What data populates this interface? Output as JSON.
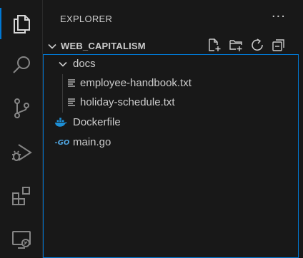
{
  "activity_bar": {
    "items": [
      {
        "icon": "files-icon",
        "active": true
      },
      {
        "icon": "search-icon",
        "active": false
      },
      {
        "icon": "source-control-icon",
        "active": false
      },
      {
        "icon": "run-debug-icon",
        "active": false
      },
      {
        "icon": "extensions-icon",
        "active": false
      },
      {
        "icon": "remote-explorer-icon",
        "active": false
      }
    ]
  },
  "explorer": {
    "title": "EXPLORER",
    "more_label": "···",
    "section": {
      "title": "WEB_CAPITALISM",
      "actions": [
        "new-file-icon",
        "new-folder-icon",
        "refresh-icon",
        "collapse-all-icon"
      ]
    },
    "tree": [
      {
        "label": "docs",
        "type": "folder",
        "expanded": true
      },
      {
        "label": "employee-handbook.txt",
        "type": "text-file"
      },
      {
        "label": "holiday-schedule.txt",
        "type": "text-file"
      },
      {
        "label": "Dockerfile",
        "type": "docker-file"
      },
      {
        "label": "main.go",
        "type": "go-file",
        "icon_text": "-GO"
      }
    ]
  },
  "colors": {
    "background": "#181818",
    "accent": "#0078d4",
    "text": "#cccccc",
    "docker": "#1d8fd6",
    "go": "#4fa3dd"
  }
}
